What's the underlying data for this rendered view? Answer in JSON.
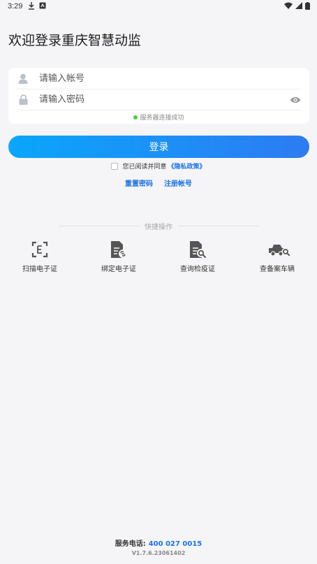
{
  "status_bar": {
    "time": "3:29"
  },
  "page": {
    "title": "欢迎登录重庆智慧动监"
  },
  "login_form": {
    "account_placeholder": "请输入帐号",
    "password_placeholder": "请输入密码",
    "server_status": "服务器连接成功"
  },
  "login_button": "登录",
  "agreement": {
    "text": "您已阅读并同意",
    "link": "《隐私政策》"
  },
  "links": {
    "reset_password": "重置密码",
    "register": "注册帐号"
  },
  "quick_actions": {
    "title": "快捷操作",
    "items": [
      {
        "label": "扫描电子证",
        "icon": "scan-icon"
      },
      {
        "label": "绑定电子证",
        "icon": "bind-certificate-icon"
      },
      {
        "label": "查询检疫证",
        "icon": "query-certificate-icon"
      },
      {
        "label": "查备案车辆",
        "icon": "vehicle-search-icon"
      }
    ]
  },
  "footer": {
    "phone_label": "服务电话:",
    "phone": "400 027 0015",
    "version": "V1.7.6.23061402"
  },
  "colors": {
    "accent": "#1a73e8",
    "button_start": "#0aa6fb",
    "button_end": "#2d7bf2",
    "status_ok": "#4cd137"
  }
}
